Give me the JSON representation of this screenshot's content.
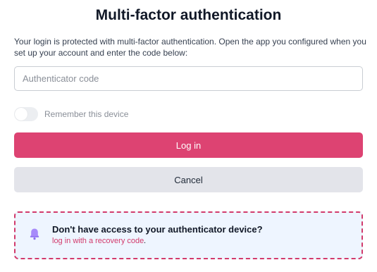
{
  "page": {
    "title": "Multi-factor authentication",
    "description": "Your login is protected with multi-factor authentication. Open the app you configured when you set up your account and enter the code below:"
  },
  "code_input": {
    "placeholder": "Authenticator code",
    "value": ""
  },
  "remember_device": {
    "label": "Remember this device",
    "enabled": false
  },
  "buttons": {
    "login_label": "Log in",
    "cancel_label": "Cancel"
  },
  "recovery_notice": {
    "icon": "bell-icon",
    "title": "Don't have access to your authenticator device?",
    "link_text": "log in with a recovery code",
    "suffix": "."
  },
  "colors": {
    "primary": "#dd4372",
    "secondary_button": "#e3e4ea",
    "notice_background": "#eef5ff",
    "notice_border": "#d23a6c",
    "icon_purple": "#a78bfa"
  }
}
